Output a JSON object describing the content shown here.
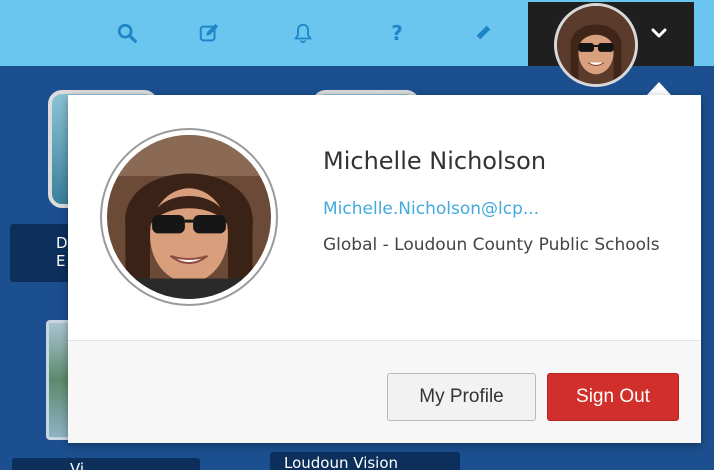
{
  "toolbar": {
    "icons": [
      "search-icon",
      "compose-icon",
      "bell-icon",
      "help-icon",
      "pencil-icon"
    ],
    "help_label": "?",
    "accent": "#1d86c9",
    "background": "#6bc6ef"
  },
  "background_labels": {
    "left_label": "D\nE",
    "bottom_label_right": "Loudoun Vision",
    "bottom_label_left": "Vi"
  },
  "user_menu": {
    "name": "Michelle Nicholson",
    "email": "Michelle.Nicholson@lcp...",
    "organization": "Global - Loudoun County Public Schools",
    "profile_button": "My Profile",
    "signout_button": "Sign Out",
    "signout_color": "#d12f2b",
    "email_color": "#43a9df"
  }
}
